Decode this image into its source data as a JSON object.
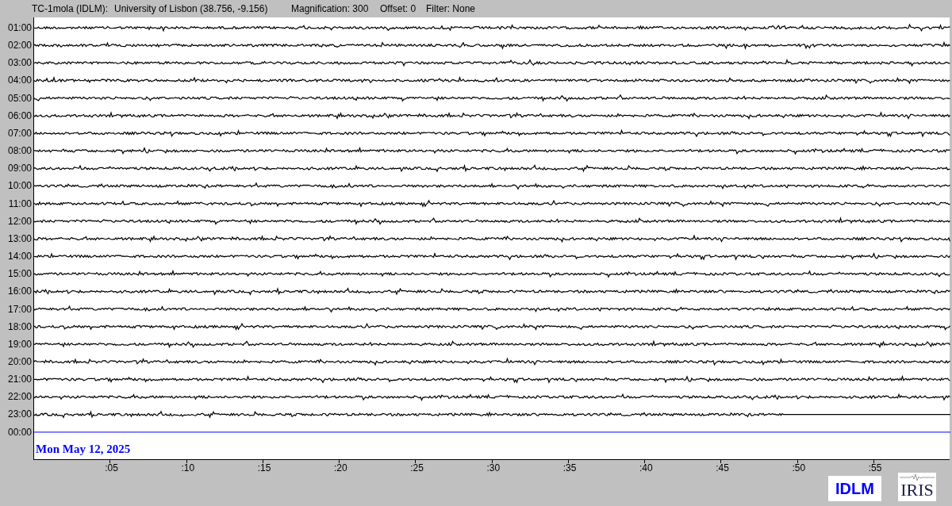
{
  "header": {
    "station": "TC-1mola (IDLM):",
    "location": "University of Lisbon (38.756, -9.156)",
    "magnification": "Magnification: 300",
    "offset": "Offset: 0",
    "filter": "Filter: None"
  },
  "rows": [
    {
      "label": "01:00",
      "kind": "full"
    },
    {
      "label": "02:00",
      "kind": "full"
    },
    {
      "label": "03:00",
      "kind": "full"
    },
    {
      "label": "04:00",
      "kind": "full"
    },
    {
      "label": "05:00",
      "kind": "full"
    },
    {
      "label": "06:00",
      "kind": "full"
    },
    {
      "label": "07:00",
      "kind": "full"
    },
    {
      "label": "08:00",
      "kind": "full"
    },
    {
      "label": "09:00",
      "kind": "full"
    },
    {
      "label": "10:00",
      "kind": "full"
    },
    {
      "label": "11:00",
      "kind": "full"
    },
    {
      "label": "12:00",
      "kind": "full"
    },
    {
      "label": "13:00",
      "kind": "full"
    },
    {
      "label": "14:00",
      "kind": "full"
    },
    {
      "label": "15:00",
      "kind": "full"
    },
    {
      "label": "16:00",
      "kind": "full"
    },
    {
      "label": "17:00",
      "kind": "full"
    },
    {
      "label": "18:00",
      "kind": "full"
    },
    {
      "label": "19:00",
      "kind": "full"
    },
    {
      "label": "20:00",
      "kind": "full"
    },
    {
      "label": "21:00",
      "kind": "full"
    },
    {
      "label": "22:00",
      "kind": "full"
    },
    {
      "label": "23:00",
      "kind": "partial"
    },
    {
      "label": "00:00",
      "kind": "current"
    }
  ],
  "date": "Mon May 12, 2025",
  "x_ticks": [
    ":05",
    ":10",
    ":15",
    ":20",
    ":25",
    ":30",
    ":35",
    ":40",
    ":45",
    ":50",
    ":55"
  ],
  "logos": {
    "network": "IDLM",
    "partner": "IRIS"
  }
}
